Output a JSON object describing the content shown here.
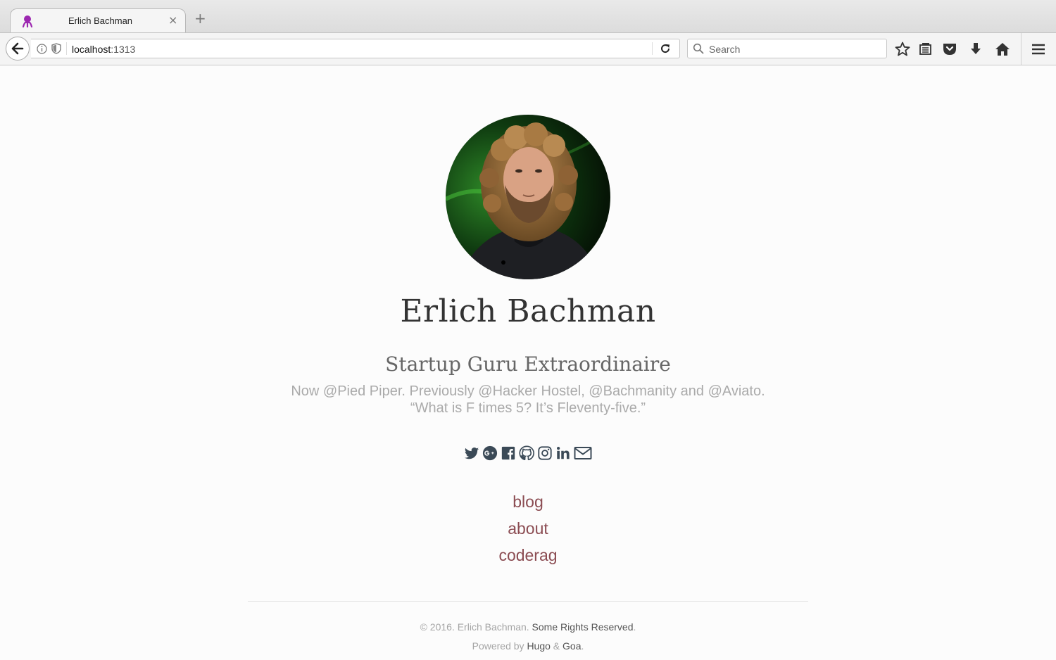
{
  "browser": {
    "tab_title": "Erlich Bachman",
    "tab_close": "×",
    "new_tab": "+",
    "url_host": "localhost",
    "url_port": ":1313",
    "search_placeholder": "Search"
  },
  "profile": {
    "name": "Erlich Bachman",
    "subtitle": "Startup Guru Extraordinaire",
    "description_line1": "Now @Pied Piper. Previously @Hacker Hostel, @Bachmanity and @Aviato.",
    "description_line2": "“What is F times 5? It’s Fleventy-five.”"
  },
  "social_icons": [
    "twitter-icon",
    "google-plus-icon",
    "facebook-icon",
    "github-icon",
    "instagram-icon",
    "linkedin-icon",
    "mail-icon"
  ],
  "nav": {
    "links": [
      {
        "label": "blog"
      },
      {
        "label": "about"
      },
      {
        "label": "coderag"
      }
    ]
  },
  "footer": {
    "copyright": "© 2016. Erlich Bachman.",
    "rights_link": "Some Rights Reserved",
    "powered_prefix": "Powered by",
    "hugo_link": "Hugo",
    "amp": "&",
    "goa_link": "Goa",
    "period": "."
  },
  "colors": {
    "link": "#8b4c52",
    "icon": "#3b4a57",
    "page_bg": "#fcfcfc"
  }
}
